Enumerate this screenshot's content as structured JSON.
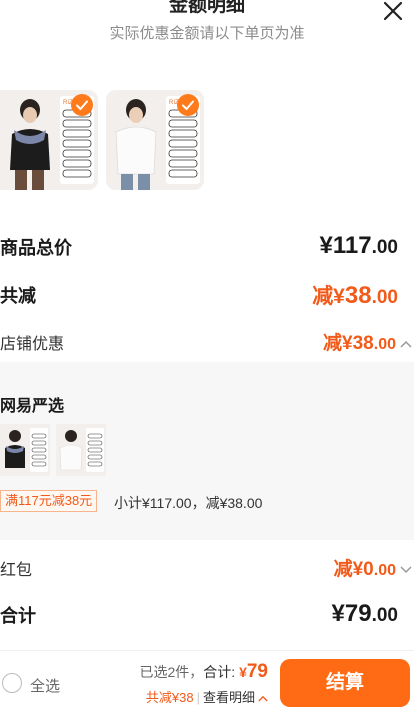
{
  "header": {
    "title": "金额明细",
    "subtitle": "实际优惠金额请以下单页为准"
  },
  "products": [
    {
      "name": "product-black-tee",
      "checked": true
    },
    {
      "name": "product-white-tee",
      "checked": true
    }
  ],
  "summary": {
    "total_label": "商品总价",
    "total_symbol": "¥",
    "total_int": "117",
    "total_dec": ".00",
    "discount_label": "共减",
    "discount_prefix": "减¥",
    "discount_int": "38",
    "discount_dec": ".00",
    "store_discount_label": "店铺优惠",
    "store_discount_prefix": "减¥",
    "store_discount_int": "38",
    "store_discount_dec": ".00"
  },
  "store": {
    "name": "网易严选",
    "promo_tag": "满117元减38元",
    "promo_text": "小计¥117.00，减¥38.00"
  },
  "redpacket": {
    "label": "红包",
    "prefix": "减¥",
    "int": "0",
    "dec": ".00"
  },
  "grand_total": {
    "label": "合计",
    "symbol": "¥",
    "int": "79",
    "dec": ".00"
  },
  "bottom_bar": {
    "select_all": "全选",
    "selected_count": "已选2件，",
    "total_label": "合计:",
    "total_symbol": "¥",
    "total_value": "79",
    "discount_text": "共减¥38",
    "details_link": "查看明细",
    "checkout_button": "结算"
  },
  "colors": {
    "accent": "#ff6a14",
    "discount_text": "#f25a1a"
  }
}
